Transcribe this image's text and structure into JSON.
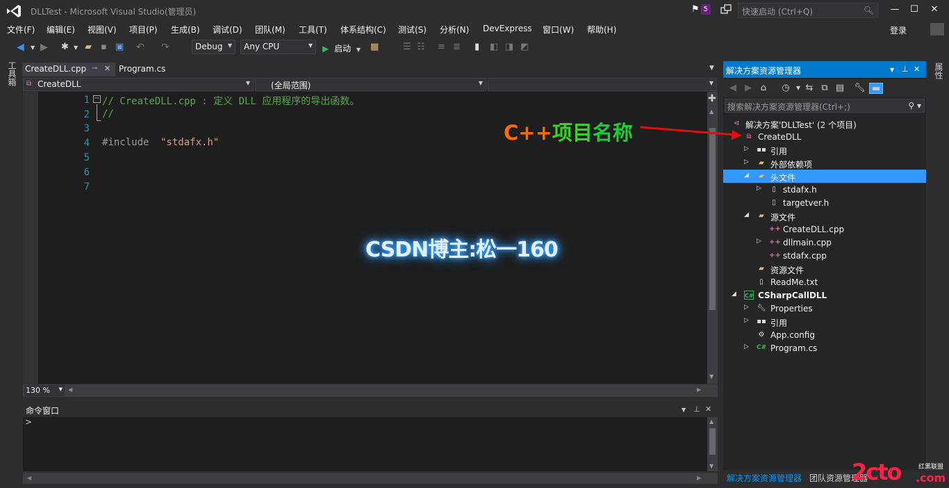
{
  "window": {
    "title": "DLLTest - Microsoft Visual Studio(管理员)",
    "notification_count": "5",
    "quick_launch_placeholder": "快速启动 (Ctrl+Q)"
  },
  "menu": [
    "文件(F)",
    "编辑(E)",
    "视图(V)",
    "项目(P)",
    "生成(B)",
    "调试(D)",
    "团队(M)",
    "工具(T)",
    "体系结构(C)",
    "测试(S)",
    "分析(N)",
    "DevExpress",
    "窗口(W)",
    "帮助(H)"
  ],
  "account": {
    "login_label": "登录"
  },
  "toolbar": {
    "config": "Debug",
    "platform": "Any CPU",
    "start_label": "启动"
  },
  "toolbox_label": "工具箱",
  "right_strip_label": "属性",
  "doc_tabs": [
    "CreateDLL.cpp",
    "Program.cs"
  ],
  "navbar": {
    "project": "CreateDLL",
    "scope": "(全局范围)"
  },
  "editor": {
    "line_numbers": [
      "1",
      "2",
      "3",
      "4",
      "5",
      "6",
      "7"
    ],
    "line1": "// CreateDLL.cpp : 定义 DLL 应用程序的导出函数。",
    "line2": "//",
    "line4_directive": "#include ",
    "line4_string": "\"stdafx.h\"",
    "watermark": "CSDN博主:松一160"
  },
  "zoom": "130 %",
  "command_window": {
    "title": "命令窗口",
    "prompt": ">"
  },
  "solution_explorer": {
    "title": "解决方案资源管理器",
    "search_placeholder": "搜索解决方案资源管理器(Ctrl+;)",
    "tree": [
      {
        "label": "解决方案'DLLTest' (2 个项目)",
        "icon": "solution-icon"
      },
      {
        "label": "CreateDLL",
        "icon": "cpp-project-icon"
      },
      {
        "label": "引用",
        "icon": "references-icon"
      },
      {
        "label": "外部依赖项",
        "icon": "folder-icon"
      },
      {
        "label": "头文件",
        "icon": "folder-icon"
      },
      {
        "label": "stdafx.h",
        "icon": "file-icon"
      },
      {
        "label": "targetver.h",
        "icon": "file-icon"
      },
      {
        "label": "源文件",
        "icon": "folder-icon"
      },
      {
        "label": "CreateDLL.cpp",
        "icon": "cpp-file-icon"
      },
      {
        "label": "dllmain.cpp",
        "icon": "cpp-file-icon"
      },
      {
        "label": "stdafx.cpp",
        "icon": "cpp-file-icon"
      },
      {
        "label": "资源文件",
        "icon": "folder-icon"
      },
      {
        "label": "ReadMe.txt",
        "icon": "file-icon"
      },
      {
        "label": "CSharpCallDLL",
        "icon": "csharp-project-icon"
      },
      {
        "label": "Properties",
        "icon": "wrench-icon"
      },
      {
        "label": "引用",
        "icon": "references-icon"
      },
      {
        "label": "App.config",
        "icon": "config-icon"
      },
      {
        "label": "Program.cs",
        "icon": "csharp-file-icon"
      }
    ],
    "bottom_tabs": [
      "解决方案资源管理器",
      "团队资源管理器"
    ]
  },
  "annotation": {
    "part1": "C++",
    "part2": "项目",
    "part3": "名称",
    "colors": [
      "#ff6a00",
      "#3ad12a",
      "#1fcc3a"
    ]
  },
  "site_watermark": {
    "main": "2cto",
    "sub": "红黑联盟",
    "com": ".com"
  },
  "colors": {
    "accent": "#007acc",
    "selection": "#3399ff",
    "comment": "#57a64a",
    "line_number": "#2b91af"
  }
}
